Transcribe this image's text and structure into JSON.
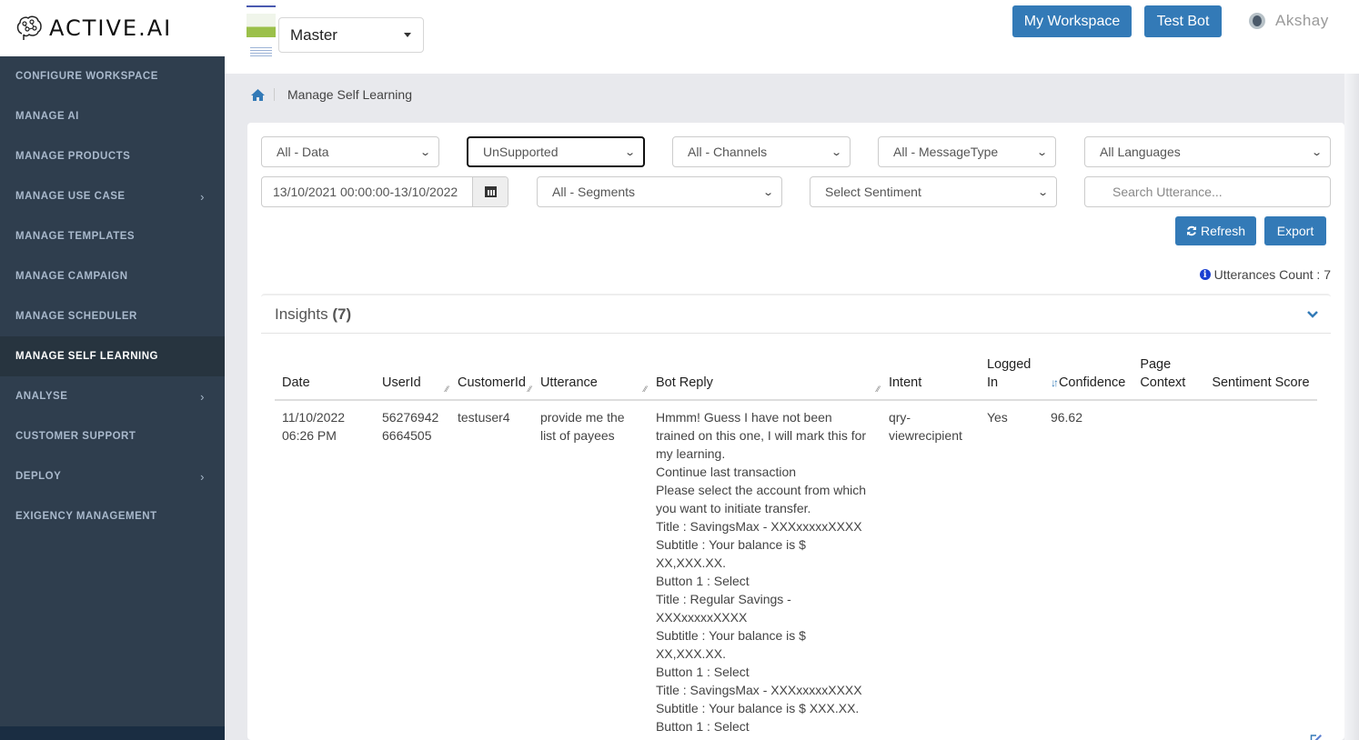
{
  "brand": {
    "name": "ACTIVE.AI",
    "icon": "brain-icon"
  },
  "sidebar": {
    "items": [
      {
        "label": "CONFIGURE WORKSPACE",
        "has_submenu": false,
        "active": false
      },
      {
        "label": "MANAGE AI",
        "has_submenu": false,
        "active": false
      },
      {
        "label": "MANAGE PRODUCTS",
        "has_submenu": false,
        "active": false
      },
      {
        "label": "MANAGE USE CASE",
        "has_submenu": true,
        "active": false
      },
      {
        "label": "MANAGE TEMPLATES",
        "has_submenu": false,
        "active": false
      },
      {
        "label": "MANAGE CAMPAIGN",
        "has_submenu": false,
        "active": false
      },
      {
        "label": "MANAGE SCHEDULER",
        "has_submenu": false,
        "active": false
      },
      {
        "label": "MANAGE SELF LEARNING",
        "has_submenu": false,
        "active": true
      },
      {
        "label": "ANALYSE",
        "has_submenu": true,
        "active": false
      },
      {
        "label": "CUSTOMER SUPPORT",
        "has_submenu": false,
        "active": false
      },
      {
        "label": "DEPLOY",
        "has_submenu": true,
        "active": false
      },
      {
        "label": "EXIGENCY MANAGEMENT",
        "has_submenu": false,
        "active": false
      }
    ],
    "chevron": "›"
  },
  "header": {
    "workspace_select": "Master",
    "my_workspace_label": "My Workspace",
    "test_bot_label": "Test Bot",
    "user_name": "Akshay"
  },
  "breadcrumb": {
    "home_icon": "home-icon",
    "current": "Manage Self Learning"
  },
  "filters": {
    "data": "All - Data",
    "support": "UnSupported",
    "channels": "All - Channels",
    "message_type": "All - MessageType",
    "languages": "All Languages",
    "date_range": "13/10/2021 00:00:00-13/10/2022",
    "segments": "All - Segments",
    "sentiment": "Select Sentiment",
    "search_placeholder": "Search Utterance...",
    "refresh_label": "Refresh",
    "export_label": "Export",
    "chevron": "⌄"
  },
  "summary": {
    "utterances_count_label": "Utterances Count : 7"
  },
  "insights": {
    "title": "Insights",
    "count": "(7)",
    "columns": [
      "Date",
      "UserId",
      "CustomerId",
      "Utterance",
      "Bot Reply",
      "Intent",
      "Logged In",
      "Confidence",
      "Page Context",
      "Sentiment Score"
    ],
    "rows": [
      {
        "date": "11/10/2022 06:26 PM",
        "user_id": "56276942 6664505",
        "customer_id": "testuser4",
        "utterance": "provide me the list of payees",
        "bot_reply": [
          "Hmmm! Guess I have not been trained on this one, I will mark this for my learning.",
          "Continue last transaction",
          "Please select the account from which you want to initiate transfer.",
          "Title : SavingsMax - XXXxxxxxXXXX",
          "Subtitle : Your balance is $ XX,XXX.XX.",
          "Button 1 : Select",
          "Title : Regular Savings - XXXxxxxxXXXX",
          "Subtitle : Your balance is $ XX,XXX.XX.",
          "Button 1 : Select",
          "Title : SavingsMax - XXXxxxxxXXXX",
          "Subtitle : Your balance is $ XXX.XX.",
          "Button 1 : Select"
        ],
        "intent": "qry-viewrecipient",
        "logged_in": "Yes",
        "confidence": "96.62",
        "page_context": "",
        "sentiment_score": ""
      }
    ]
  },
  "colors": {
    "primary": "#337ab7",
    "sidebar_bg": "#2f3e4e",
    "sidebar_active": "#27343f",
    "page_bg": "#e8e9ed"
  }
}
